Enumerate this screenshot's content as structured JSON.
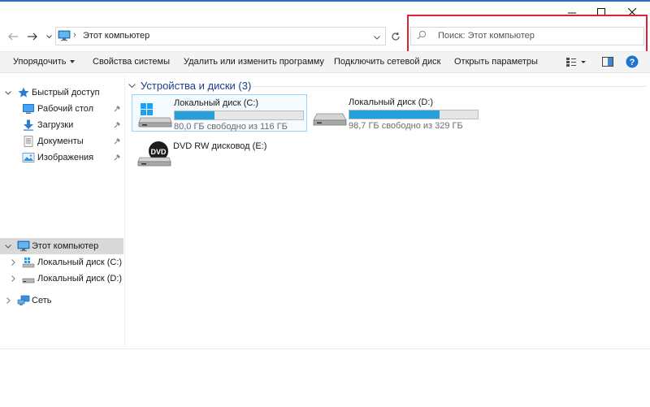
{
  "window": {
    "controls": {
      "minimize": "minimize-icon",
      "maximize": "maximize-icon",
      "close": "close-icon"
    }
  },
  "address": {
    "path": "Этот компьютер",
    "icon": "computer-icon"
  },
  "search": {
    "placeholder": "Поиск: Этот компьютер"
  },
  "toolbar": {
    "organize": "Упорядочить",
    "system_properties": "Свойства системы",
    "uninstall": "Удалить или изменить программу",
    "map_drive": "Подключить сетевой диск",
    "open_settings": "Открыть параметры"
  },
  "nav": {
    "quick_access": "Быстрый доступ",
    "quick_items": [
      {
        "label": "Рабочий стол",
        "icon": "desktop-icon"
      },
      {
        "label": "Загрузки",
        "icon": "downloads-icon"
      },
      {
        "label": "Документы",
        "icon": "documents-icon"
      },
      {
        "label": "Изображения",
        "icon": "pictures-icon"
      }
    ],
    "this_pc": "Этот компьютер",
    "drives": [
      {
        "label": "Локальный диск (C:)"
      },
      {
        "label": "Локальный диск (D:)"
      }
    ],
    "network": "Сеть"
  },
  "content": {
    "group_title": "Устройства и диски (3)",
    "drives": [
      {
        "name": "Локальный диск (C:)",
        "free": "80,0 ГБ свободно из 116 ГБ",
        "used_fraction": 0.31
      },
      {
        "name": "Локальный диск (D:)",
        "free": "98,7 ГБ свободно из 329 ГБ",
        "used_fraction": 0.7
      },
      {
        "name": "DVD RW дисковод (E:)",
        "badge": "DVD"
      }
    ]
  },
  "colors": {
    "accent": "#26a0da",
    "highlight_border": "#d7262f",
    "group_title": "#1e3a8c",
    "help": "#1f73d1"
  }
}
